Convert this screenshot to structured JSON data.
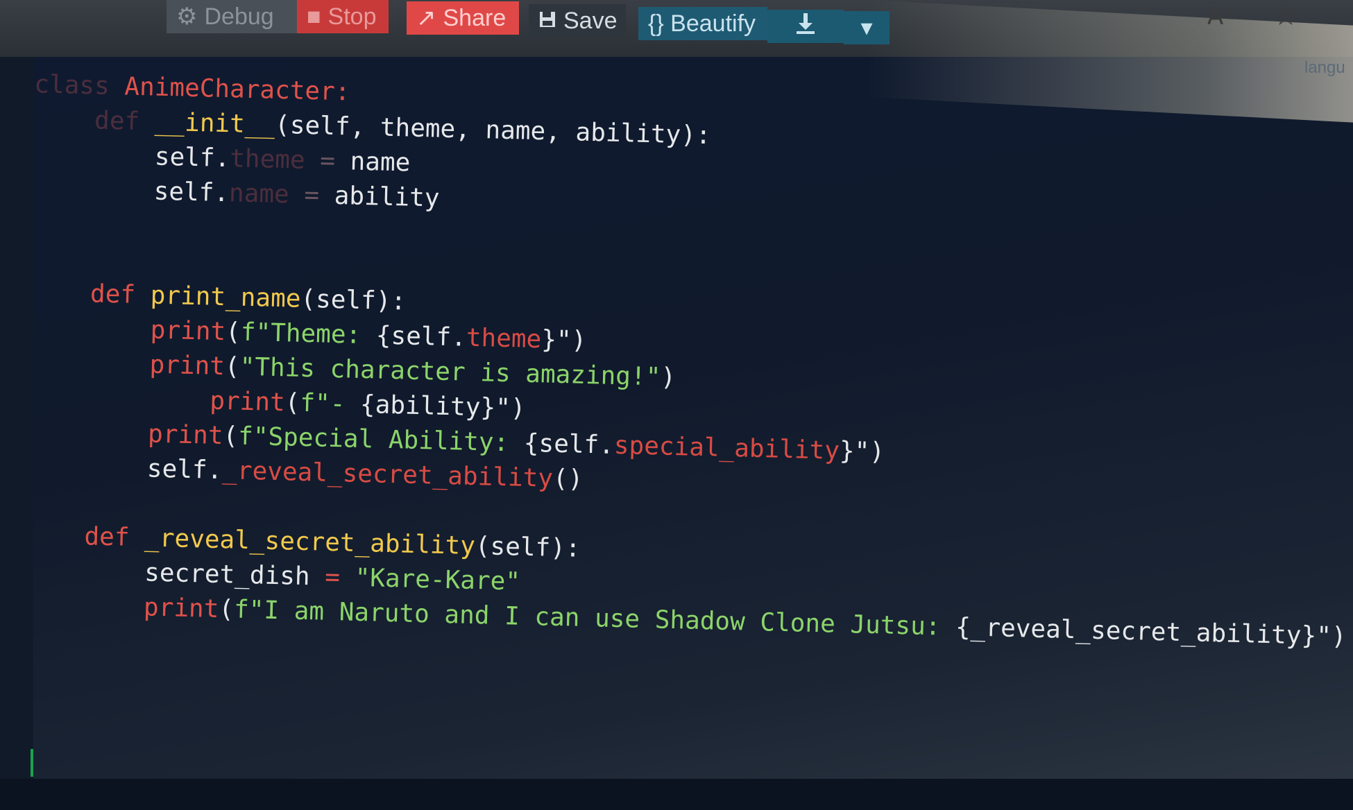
{
  "toolbar": {
    "debug_label": "Debug",
    "stop_label": "Stop",
    "share_label": "Share",
    "save_label": "Save",
    "beautify_label": "{} Beautify"
  },
  "topbar": {
    "font_size_glyph": "A⁺",
    "star_glyph": "☆"
  },
  "editor": {
    "language_label": "langu",
    "lines": [
      {
        "indent": 0,
        "tokens": [
          {
            "t": "class ",
            "c": "dim"
          },
          {
            "t": "AnimeCharacter:",
            "c": "kw"
          }
        ]
      },
      {
        "indent": 1,
        "tokens": [
          {
            "t": "def ",
            "c": "dim"
          },
          {
            "t": "__init__",
            "c": "fn"
          },
          {
            "t": "(self, theme, name, ability):",
            "c": "txt"
          }
        ]
      },
      {
        "indent": 2,
        "tokens": [
          {
            "t": "self.",
            "c": "txt"
          },
          {
            "t": "theme",
            "c": "dim"
          },
          {
            "t": " = ",
            "c": "op"
          },
          {
            "t": "name",
            "c": "txt"
          }
        ]
      },
      {
        "indent": 2,
        "tokens": [
          {
            "t": "self.",
            "c": "txt"
          },
          {
            "t": "name",
            "c": "dim"
          },
          {
            "t": " = ",
            "c": "op"
          },
          {
            "t": "ability",
            "c": "txt"
          }
        ]
      },
      {
        "indent": 0,
        "tokens": []
      },
      {
        "indent": 0,
        "tokens": []
      },
      {
        "indent": 1,
        "tokens": [
          {
            "t": "def ",
            "c": "kw"
          },
          {
            "t": "print_name",
            "c": "fn"
          },
          {
            "t": "(self):",
            "c": "txt"
          }
        ]
      },
      {
        "indent": 2,
        "tokens": [
          {
            "t": "print",
            "c": "kw"
          },
          {
            "t": "(",
            "c": "txt"
          },
          {
            "t": "f\"Theme: ",
            "c": "str"
          },
          {
            "t": "{self.",
            "c": "txt"
          },
          {
            "t": "theme",
            "c": "attr"
          },
          {
            "t": "}",
            "c": "txt"
          },
          {
            "t": "\")",
            "c": "txt"
          }
        ]
      },
      {
        "indent": 2,
        "tokens": [
          {
            "t": "print",
            "c": "kw"
          },
          {
            "t": "(",
            "c": "txt"
          },
          {
            "t": "\"This character is amazing!\"",
            "c": "str"
          },
          {
            "t": ")",
            "c": "txt"
          }
        ]
      },
      {
        "indent": 3,
        "tokens": [
          {
            "t": "print",
            "c": "kw"
          },
          {
            "t": "(",
            "c": "txt"
          },
          {
            "t": "f\"- ",
            "c": "str"
          },
          {
            "t": "{ability}",
            "c": "txt"
          },
          {
            "t": "\")",
            "c": "txt"
          }
        ]
      },
      {
        "indent": 2,
        "tokens": [
          {
            "t": "print",
            "c": "kw"
          },
          {
            "t": "(",
            "c": "txt"
          },
          {
            "t": "f\"Special Ability: ",
            "c": "str"
          },
          {
            "t": "{self.",
            "c": "txt"
          },
          {
            "t": "special_ability",
            "c": "attr"
          },
          {
            "t": "}",
            "c": "txt"
          },
          {
            "t": "\")",
            "c": "txt"
          }
        ]
      },
      {
        "indent": 2,
        "tokens": [
          {
            "t": "self.",
            "c": "txt"
          },
          {
            "t": "_reveal_secret_ability",
            "c": "attr"
          },
          {
            "t": "()",
            "c": "txt"
          }
        ]
      },
      {
        "indent": 0,
        "tokens": []
      },
      {
        "indent": 1,
        "tokens": [
          {
            "t": "def ",
            "c": "kw"
          },
          {
            "t": "_reveal_secret_ability",
            "c": "fn"
          },
          {
            "t": "(self):",
            "c": "txt"
          }
        ]
      },
      {
        "indent": 2,
        "tokens": [
          {
            "t": "secret_dish",
            "c": "txt"
          },
          {
            "t": " = ",
            "c": "kw"
          },
          {
            "t": "\"Kare-Kare\"",
            "c": "str"
          }
        ]
      },
      {
        "indent": 2,
        "tokens": [
          {
            "t": "print",
            "c": "kw"
          },
          {
            "t": "(",
            "c": "txt"
          },
          {
            "t": "f\"I am Naruto and I can use Shadow Clone Jutsu: ",
            "c": "str"
          },
          {
            "t": "{_reveal_secret_ability}",
            "c": "txt"
          },
          {
            "t": "\")",
            "c": "txt"
          }
        ]
      }
    ]
  }
}
